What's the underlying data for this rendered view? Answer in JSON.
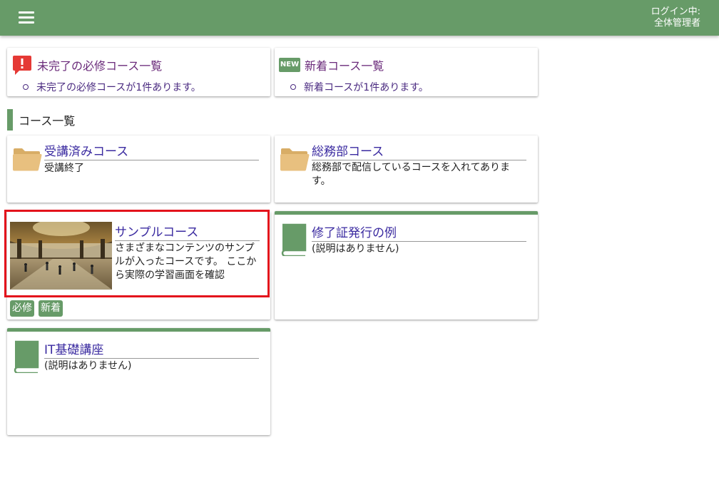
{
  "header": {
    "login_status": "ログイン中:",
    "user_name": "全体管理者"
  },
  "notices": [
    {
      "icon": "alert-icon",
      "title": "未完了の必修コース一覧",
      "item": "未完了の必修コースが1件あります。"
    },
    {
      "icon": "new-badge-icon",
      "badge_text": "NEW",
      "title": "新着コース一覧",
      "item": "新着コースが1件あります。"
    }
  ],
  "section": {
    "title": "コース一覧"
  },
  "courses": [
    {
      "title": "受講済みコース",
      "description": "受講終了",
      "icon": "folder-icon"
    },
    {
      "title": "総務部コース",
      "description": "総務部で配信しているコースを入れてあります。",
      "icon": "folder-icon"
    },
    {
      "title": "サンプルコース",
      "description": "さまざまなコンテンツのサンプルが入ったコースです。 ここから実際の学習画面を確認",
      "icon": "course-thumbnail",
      "tags": [
        "必修",
        "新着"
      ]
    },
    {
      "title": "修了証発行の例",
      "description": "(説明はありません)",
      "icon": "book-icon"
    },
    {
      "title": "IT基礎講座",
      "description": "(説明はありません)",
      "icon": "book-icon"
    }
  ],
  "colors": {
    "brand_green": "#679b68",
    "alert_red": "#e53935",
    "folder_tan": "#e8c07f",
    "highlight_red": "#e3131c"
  }
}
